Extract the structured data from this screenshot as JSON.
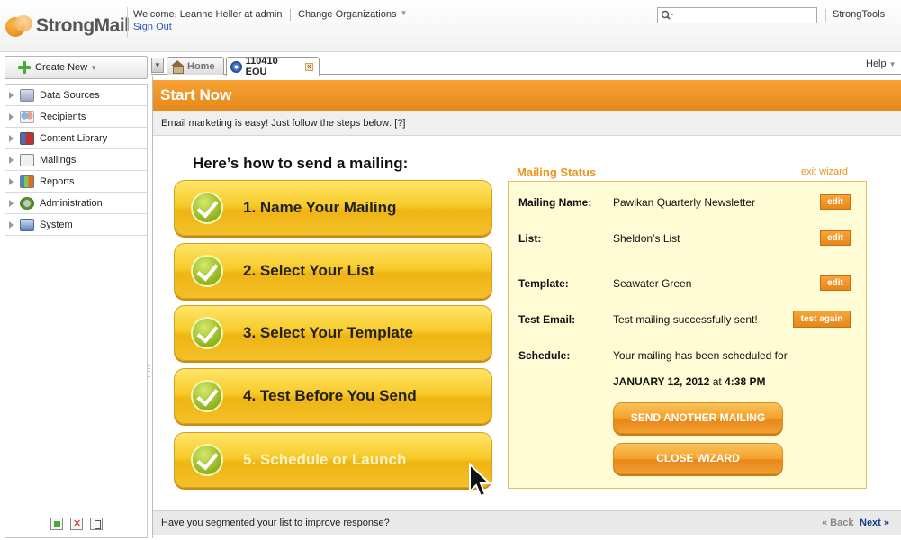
{
  "header": {
    "logo_text": "StrongMail",
    "welcome": "Welcome, Leanne Heller at admin",
    "sign_out": "Sign Out",
    "change_org": "Change Organizations",
    "search_value": "",
    "strongtools": "StrongTools"
  },
  "sidebar": {
    "create_new": "Create New",
    "items": [
      {
        "label": "Data Sources",
        "icon": "data-sources-icon"
      },
      {
        "label": "Recipients",
        "icon": "recipients-icon"
      },
      {
        "label": "Content Library",
        "icon": "content-library-icon"
      },
      {
        "label": "Mailings",
        "icon": "mailings-icon"
      },
      {
        "label": "Reports",
        "icon": "reports-icon"
      },
      {
        "label": "Administration",
        "icon": "administration-icon"
      },
      {
        "label": "System",
        "icon": "system-icon"
      }
    ]
  },
  "tabs": {
    "home": "Home",
    "active": "110410 EOU",
    "help": "Help"
  },
  "main": {
    "title": "Start Now",
    "intro": "Email marketing is easy! Just follow the steps below: [?]",
    "howto": "Here’s how to send a mailing:",
    "steps": [
      "1. Name Your Mailing",
      "2. Select Your List",
      "3. Select Your Template",
      "4. Test Before You Send",
      "5. Schedule or Launch"
    ]
  },
  "status": {
    "heading": "Mailing Status",
    "exit_wizard": "exit wizard",
    "rows": [
      {
        "label": "Mailing Name:",
        "value": "Pawikan Quarterly Newsletter",
        "button": "edit"
      },
      {
        "label": "List:",
        "value": "Sheldon’s List",
        "button": "edit"
      },
      {
        "label": "Template:",
        "value": "Seawater Green",
        "button": "edit"
      },
      {
        "label": "Test Email:",
        "value": "Test mailing successfully sent!",
        "button": "test again"
      },
      {
        "label": "Schedule:",
        "value": "Your mailing has been scheduled for"
      }
    ],
    "schedule_date": "JANUARY 12, 2012",
    "schedule_at": "at",
    "schedule_time": "4:38 PM",
    "send_another": "SEND ANOTHER MAILING",
    "close_wizard": "CLOSE WIZARD"
  },
  "footer": {
    "text": "Have you segmented your list to improve response?",
    "back": "« Back",
    "next": "Next »"
  },
  "colors": {
    "accent_orange": "#e6891a",
    "step_yellow": "#f7cb2a",
    "status_bg": "#fffbd4",
    "link_blue": "#1a3f8a"
  }
}
